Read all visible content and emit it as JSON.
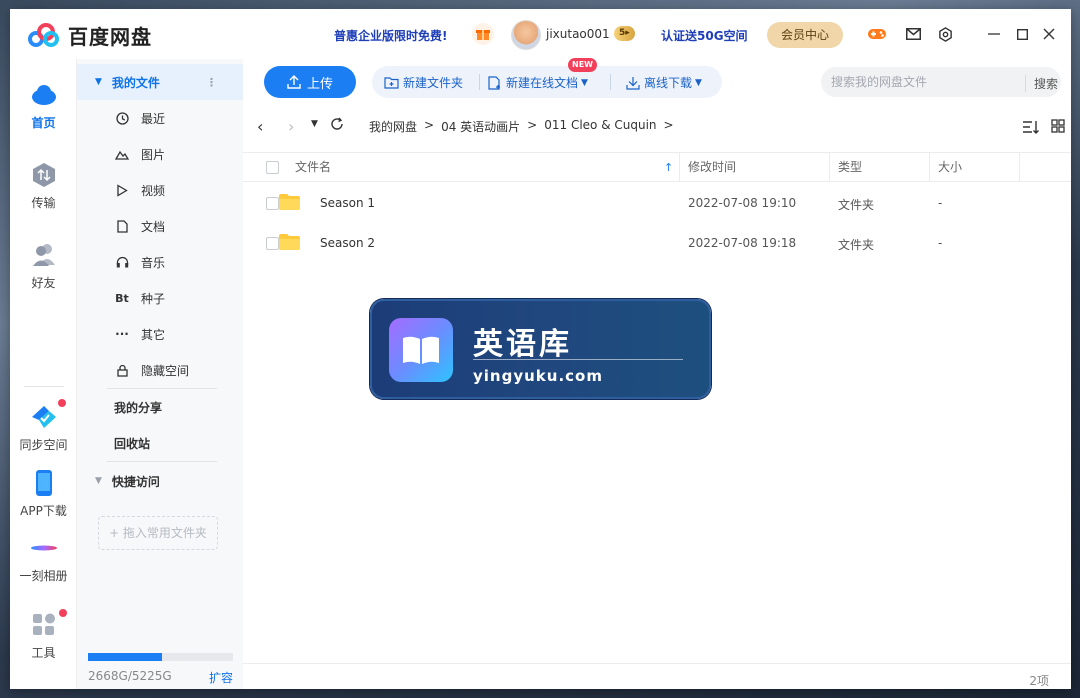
{
  "app": {
    "name": "百度网盘",
    "promo": "普惠企业版限时免费!",
    "username": "jixutao001",
    "vip_level": "5",
    "cert_link": "认证送50G空间",
    "member_button": "会员中心",
    "colors": {
      "accent": "#1b7ef3",
      "link": "#1f3fb8",
      "member_bg": "#f0d6a8"
    }
  },
  "rail": {
    "items": [
      {
        "label": "首页",
        "icon": "cloud-icon"
      },
      {
        "label": "传输",
        "icon": "transfer-icon"
      },
      {
        "label": "好友",
        "icon": "friends-icon"
      },
      {
        "label": "同步空间",
        "icon": "sync-icon"
      },
      {
        "label": "APP下载",
        "icon": "phone-icon"
      },
      {
        "label": "一刻相册",
        "icon": "album-icon"
      },
      {
        "label": "工具",
        "icon": "tools-icon"
      }
    ]
  },
  "sidenav": {
    "my_files": "我的文件",
    "categories": [
      {
        "label": "最近",
        "icon": "clock-icon"
      },
      {
        "label": "图片",
        "icon": "image-icon"
      },
      {
        "label": "视频",
        "icon": "play-icon"
      },
      {
        "label": "文档",
        "icon": "document-icon"
      },
      {
        "label": "音乐",
        "icon": "headphones-icon"
      },
      {
        "label": "种子",
        "icon": "torrent-icon",
        "glyph": "Bt"
      },
      {
        "label": "其它",
        "icon": "more-icon"
      },
      {
        "label": "隐藏空间",
        "icon": "lock-icon"
      }
    ],
    "my_share": "我的分享",
    "recycle_bin": "回收站",
    "quick_access": "快捷访问",
    "drop_hint": "+ 拖入常用文件夹",
    "storage_text": "2668G/5225G",
    "storage_fraction": 0.51,
    "expand": "扩容"
  },
  "toolbar": {
    "upload": "上传",
    "new_folder": "新建文件夹",
    "new_online_doc": "新建在线文档",
    "new_badge": "NEW",
    "offline_download": "离线下载",
    "search_placeholder": "搜索我的网盘文件",
    "search_button": "搜索"
  },
  "breadcrumb": [
    "我的网盘",
    ">",
    "04 英语动画片",
    ">",
    "011 Cleo & Cuquin",
    ">"
  ],
  "table": {
    "columns": [
      "文件名",
      "修改时间",
      "类型",
      "大小"
    ],
    "rows": [
      {
        "name": "Season 1",
        "modified": "2022-07-08 19:10",
        "type": "文件夹",
        "size": "-"
      },
      {
        "name": "Season 2",
        "modified": "2022-07-08 19:18",
        "type": "文件夹",
        "size": "-"
      }
    ]
  },
  "footer": {
    "count": "2项"
  },
  "watermark": {
    "title": "英语库",
    "url": "yingyuku.com"
  }
}
